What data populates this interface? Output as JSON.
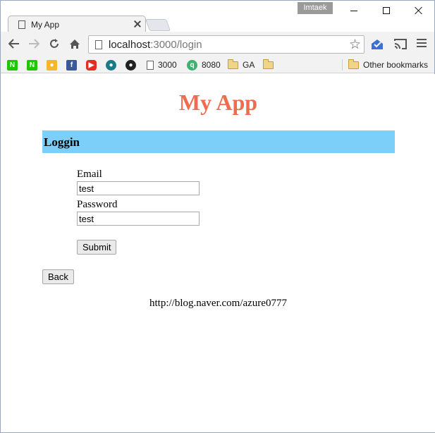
{
  "browser": {
    "user_badge": "Imtaek",
    "tab": {
      "title": "My App"
    },
    "address": {
      "host": "localhost",
      "path": ":3000/login"
    },
    "bookmarks": [
      {
        "label": "",
        "icon": "naver-n-icon",
        "color": "#1ec800"
      },
      {
        "label": "",
        "icon": "naver-n-icon",
        "color": "#1ec800"
      },
      {
        "label": "",
        "icon": "lightbulb-icon",
        "color": "#f7b529"
      },
      {
        "label": "",
        "icon": "facebook-icon",
        "color": "#3b5998"
      },
      {
        "label": "",
        "icon": "youtube-icon",
        "color": "#e52d27"
      },
      {
        "label": "",
        "icon": "app-icon",
        "color": "#1a7a8a"
      },
      {
        "label": "",
        "icon": "github-icon",
        "color": "#222222"
      },
      {
        "label": "3000",
        "icon": "page-icon"
      },
      {
        "label": "8080",
        "icon": "q-icon",
        "color": "#3cb371"
      },
      {
        "label": "GA",
        "icon": "folder-icon"
      },
      {
        "label": "",
        "icon": "folder-icon"
      }
    ],
    "other_bookmarks": "Other bookmarks"
  },
  "page": {
    "app_title": "My App",
    "section_title": "Loggin",
    "form": {
      "email_label": "Email",
      "email_value": "test",
      "password_label": "Password",
      "password_value": "test",
      "submit_label": "Submit"
    },
    "back_label": "Back",
    "footer_link": "http://blog.naver.com/azure0777"
  },
  "colors": {
    "title": "#f06c4f",
    "section_bar": "#7ccff9"
  }
}
